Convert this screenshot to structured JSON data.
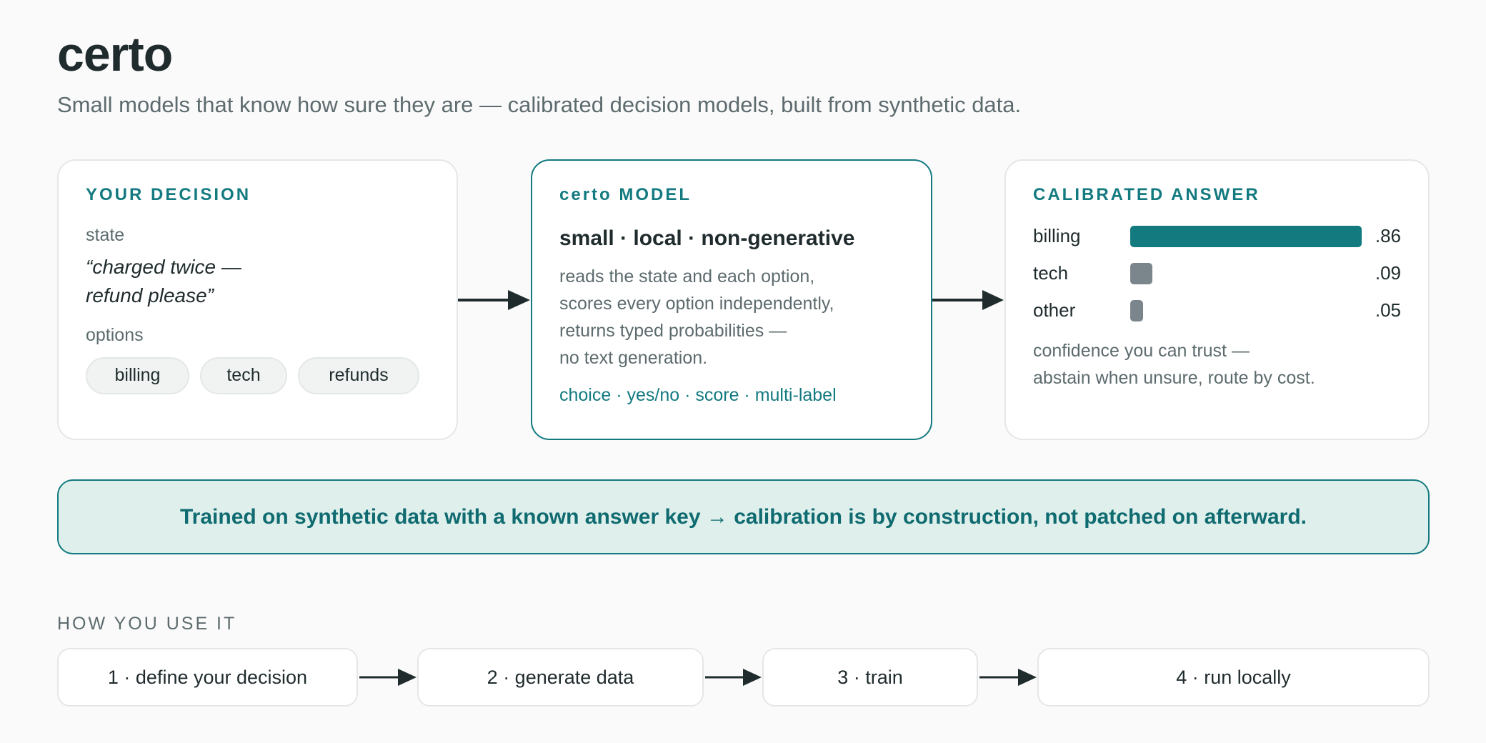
{
  "header": {
    "title": "certo",
    "subtitle": "Small models that know how sure they are — calibrated decision models, built from synthetic data."
  },
  "decision_card": {
    "heading": "YOUR DECISION",
    "state_label": "state",
    "state_line1": "“charged twice —",
    "state_line2": "refund please”",
    "options_label": "options",
    "options": [
      "billing",
      "tech",
      "refunds"
    ]
  },
  "model_card": {
    "heading": "certo MODEL",
    "tagline": "small · local · non-generative",
    "description": [
      "reads the state and each option,",
      "scores every option independently,",
      "returns typed probabilities —",
      "no text generation."
    ],
    "types": "choice · yes/no · score · multi-label"
  },
  "answer_card": {
    "heading": "CALIBRATED ANSWER",
    "results": [
      {
        "label": "billing",
        "display": ".86",
        "probability": 0.86,
        "color": "#137a80"
      },
      {
        "label": "tech",
        "display": ".09",
        "probability": 0.09,
        "color": "#7b868c"
      },
      {
        "label": "other",
        "display": ".05",
        "probability": 0.05,
        "color": "#7b868c"
      }
    ],
    "note_line1": "confidence you can trust —",
    "note_line2": "abstain when unsure, route by cost."
  },
  "banner": {
    "text": "Trained on synthetic data with a known answer key → calibration is by construction, not patched on afterward."
  },
  "how_to": {
    "label": "HOW YOU USE IT",
    "steps": [
      "1 · define your decision",
      "2 · generate data",
      "3 · train",
      "4 · run locally"
    ]
  },
  "colors": {
    "accent": "#137a80",
    "text": "#1f2b2d",
    "muted": "#5d6b6e",
    "banner_bg": "#dfefec",
    "bar_muted": "#7b868c"
  }
}
